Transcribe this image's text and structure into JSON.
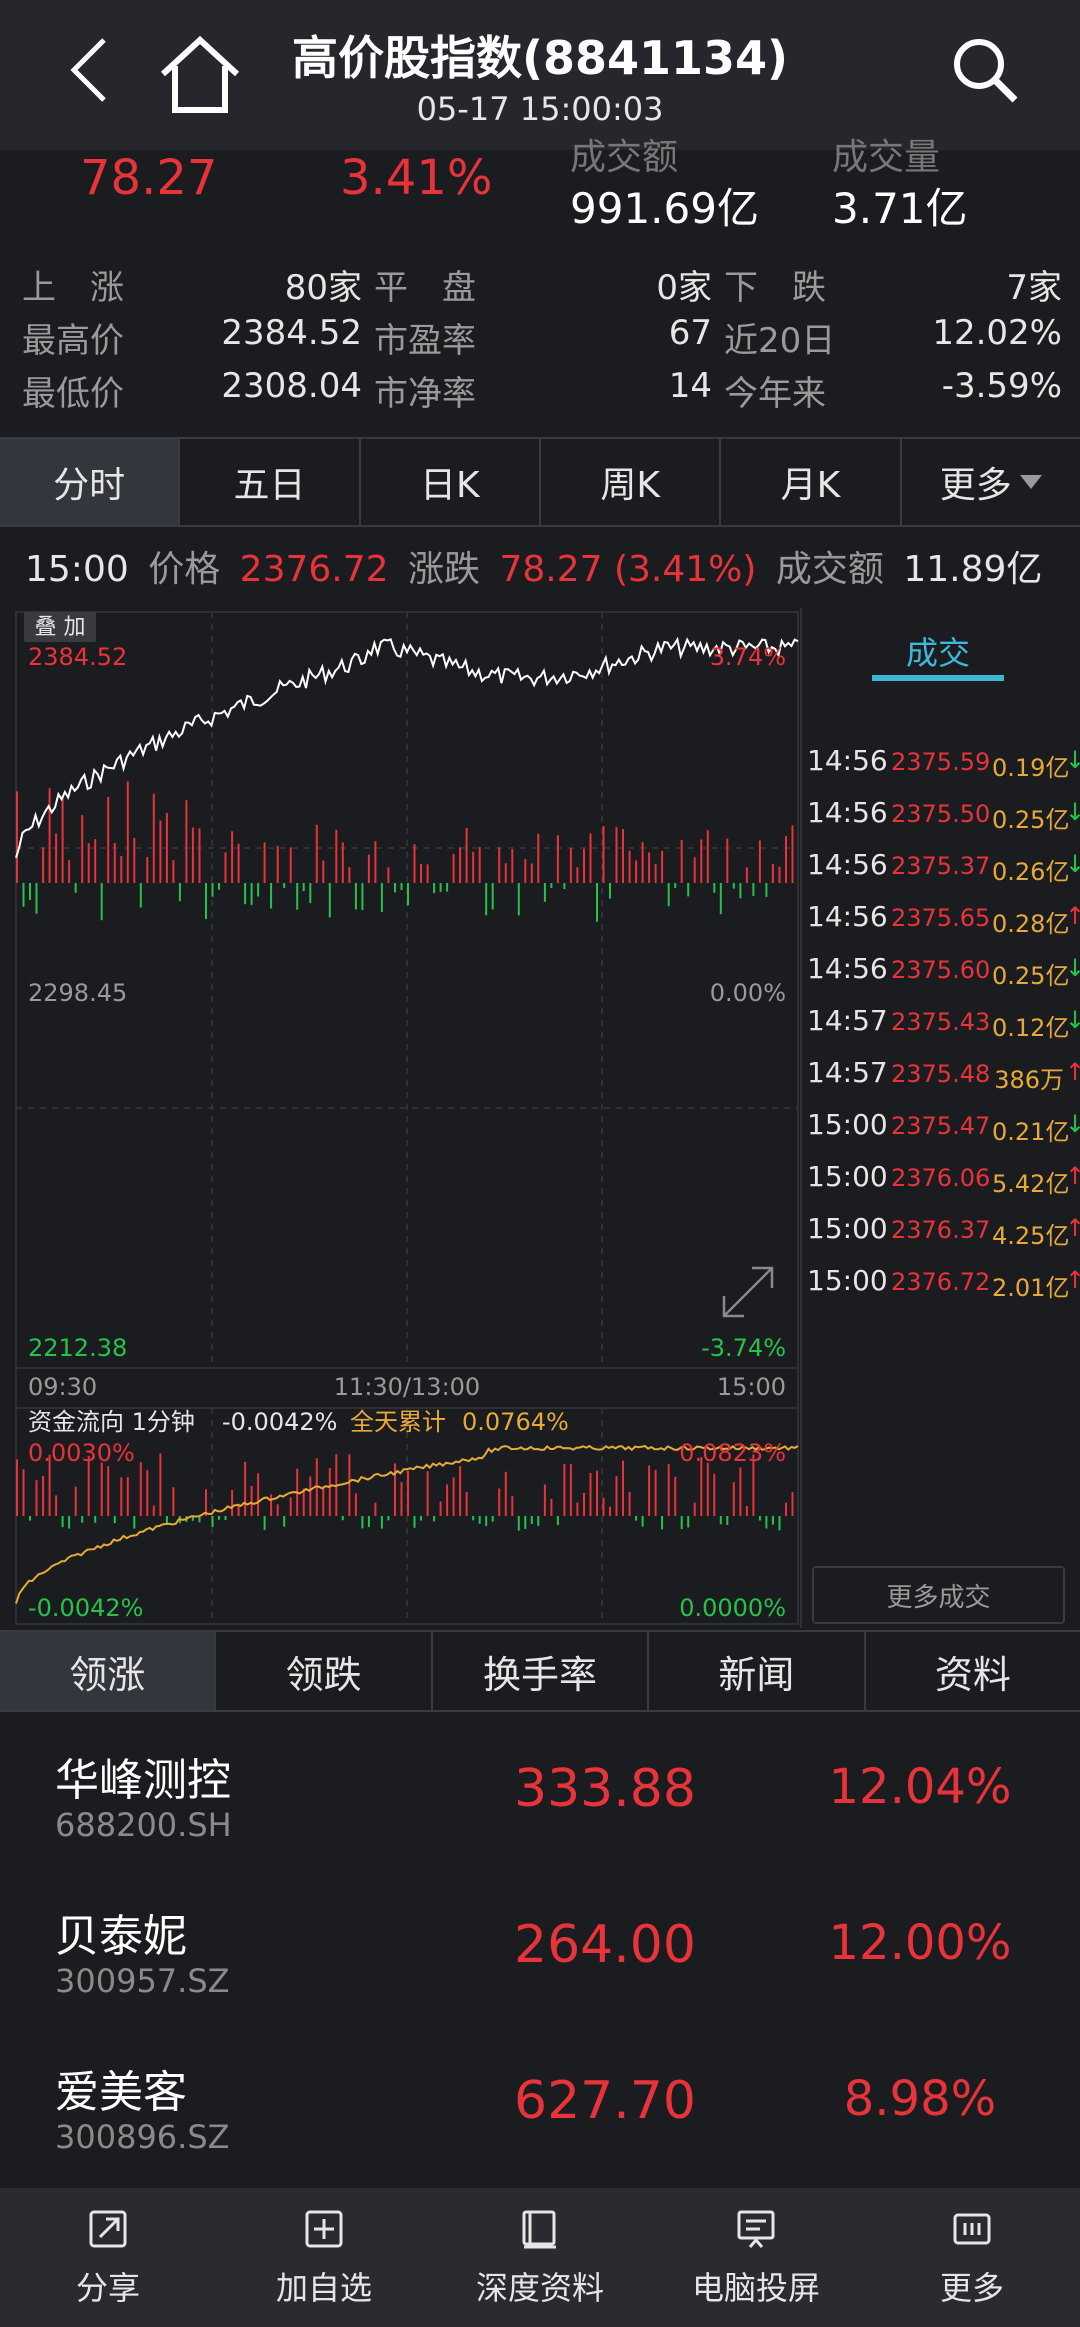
{
  "header": {
    "title": "高价股指数(8841134)",
    "subtitle": "05-17 15:00:03"
  },
  "summary": {
    "change": "78.27",
    "change_pct": "3.41%",
    "amount_label": "成交额",
    "amount": "991.69亿",
    "volume_label": "成交量",
    "volume": "3.71亿",
    "rows": [
      [
        {
          "l": "上　涨",
          "v": "80家"
        },
        {
          "l": "平　盘",
          "v": "0家"
        },
        {
          "l": "下　跌",
          "v": "7家"
        }
      ],
      [
        {
          "l": "最高价",
          "v": "2384.52"
        },
        {
          "l": "市盈率",
          "v": "67"
        },
        {
          "l": "近20日",
          "v": "12.02%"
        }
      ],
      [
        {
          "l": "最低价",
          "v": "2308.04"
        },
        {
          "l": "市净率",
          "v": "14"
        },
        {
          "l": "今年来",
          "v": "-3.59%"
        }
      ]
    ]
  },
  "period_tabs": [
    "分时",
    "五日",
    "日K",
    "周K",
    "月K",
    "更多"
  ],
  "infoline": {
    "time": "15:00",
    "price_label": "价格",
    "price": "2376.72",
    "change_label": "涨跌",
    "change": "78.27 (3.41%)",
    "amount_label": "成交额",
    "amount": "11.89亿"
  },
  "chart": {
    "overlay_label": "叠 加",
    "high": "2384.52",
    "high_pct": "3.74%",
    "mid": "2298.45",
    "mid_pct": "0.00%",
    "low": "2212.38",
    "low_pct": "-3.74%",
    "x_start": "09:30",
    "x_mid": "11:30/13:00",
    "x_end": "15:00",
    "flow_label": "资金流向 1分钟",
    "flow_value": "-0.0042%",
    "flow_total_label": "全天累计",
    "flow_total": "0.0764%",
    "flow_top_left": "0.0030%",
    "flow_top_right": "0.0823%",
    "flow_bottom_left": "-0.0042%",
    "flow_bottom_right": "0.0000%"
  },
  "trades": {
    "tab": "成交",
    "more": "更多成交",
    "rows": [
      {
        "time": "14:56",
        "price": "2375.59",
        "vol": "0.19亿",
        "dir": "↓"
      },
      {
        "time": "14:56",
        "price": "2375.50",
        "vol": "0.25亿",
        "dir": "↓"
      },
      {
        "time": "14:56",
        "price": "2375.37",
        "vol": "0.26亿",
        "dir": "↓"
      },
      {
        "time": "14:56",
        "price": "2375.65",
        "vol": "0.28亿",
        "dir": "↑"
      },
      {
        "time": "14:56",
        "price": "2375.60",
        "vol": "0.25亿",
        "dir": "↓"
      },
      {
        "time": "14:57",
        "price": "2375.43",
        "vol": "0.12亿",
        "dir": "↓"
      },
      {
        "time": "14:57",
        "price": "2375.48",
        "vol": "386万",
        "dir": "↑"
      },
      {
        "time": "15:00",
        "price": "2375.47",
        "vol": "0.21亿",
        "dir": "↓"
      },
      {
        "time": "15:00",
        "price": "2376.06",
        "vol": "5.42亿",
        "dir": "↑"
      },
      {
        "time": "15:00",
        "price": "2376.37",
        "vol": "4.25亿",
        "dir": "↑"
      },
      {
        "time": "15:00",
        "price": "2376.72",
        "vol": "2.01亿",
        "dir": "↑"
      }
    ]
  },
  "rank_tabs": [
    "领涨",
    "领跌",
    "换手率",
    "新闻",
    "资料"
  ],
  "stocks": [
    {
      "name": "华峰测控",
      "code": "688200.SH",
      "price": "333.88",
      "pct": "12.04%"
    },
    {
      "name": "贝泰妮",
      "code": "300957.SZ",
      "price": "264.00",
      "pct": "12.00%"
    },
    {
      "name": "爱美客",
      "code": "300896.SZ",
      "price": "627.70",
      "pct": "8.98%"
    }
  ],
  "bottom_bar": [
    {
      "label": "分享",
      "icon": "share-icon"
    },
    {
      "label": "加自选",
      "icon": "add-watchlist-icon"
    },
    {
      "label": "深度资料",
      "icon": "book-icon"
    },
    {
      "label": "电脑投屏",
      "icon": "cast-icon"
    },
    {
      "label": "更多",
      "icon": "more-icon"
    }
  ],
  "colors": {
    "up": "#e8333a",
    "down": "#27c24c",
    "accent": "#3fb7d8",
    "flow": "#e7a93a"
  }
}
